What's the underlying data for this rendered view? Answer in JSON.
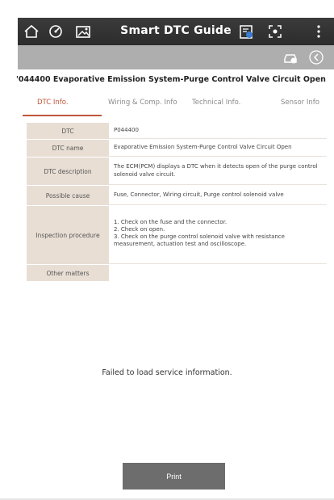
{
  "header": {
    "title": "Smart DTC Guide",
    "left_icons": [
      "home-icon",
      "gauge-icon",
      "image-icon"
    ],
    "right_icons": [
      "report-icon",
      "capture-icon",
      "more-icon"
    ]
  },
  "subbar": {
    "icons": [
      "car-scan-icon",
      "back-icon"
    ]
  },
  "page": {
    "title": "'044400 Evaporative Emission System-Purge Control Valve Circuit Open"
  },
  "tabs": [
    {
      "label": "DTC Info.",
      "active": true
    },
    {
      "label": "Wiring & Comp. Info",
      "active": false
    },
    {
      "label": "Technical Info.",
      "active": false
    },
    {
      "label": "Sensor Info",
      "active": false
    }
  ],
  "table": {
    "rows": [
      {
        "label": "DTC",
        "value": "P044400"
      },
      {
        "label": "DTC name",
        "value": "Evaporative Emission System-Purge Control Valve Circuit Open"
      },
      {
        "label": "DTC description",
        "value": "The ECM(PCM) displays a DTC when it detects open of the purge control solenoid valve circuit."
      },
      {
        "label": "Possible cause",
        "value": "Fuse, Connector, Wiring circuit, Purge control solenoid valve"
      },
      {
        "label": "Inspection procedure",
        "lines": [
          "1. Check on the fuse and the connector.",
          "2. Check on open.",
          "3. Check on the purge control solenoid valve with resistance measurement, actuation test and oscilloscope."
        ]
      },
      {
        "label": "Other matters",
        "value": ""
      }
    ]
  },
  "message": "Failed to load service information.",
  "print_label": "Print",
  "colors": {
    "accent": "#c0553a",
    "label_bg": "#e8ded4",
    "topbar": "#2f2f2f",
    "subbar": "#aeaeae",
    "button": "#6d6d6d"
  }
}
